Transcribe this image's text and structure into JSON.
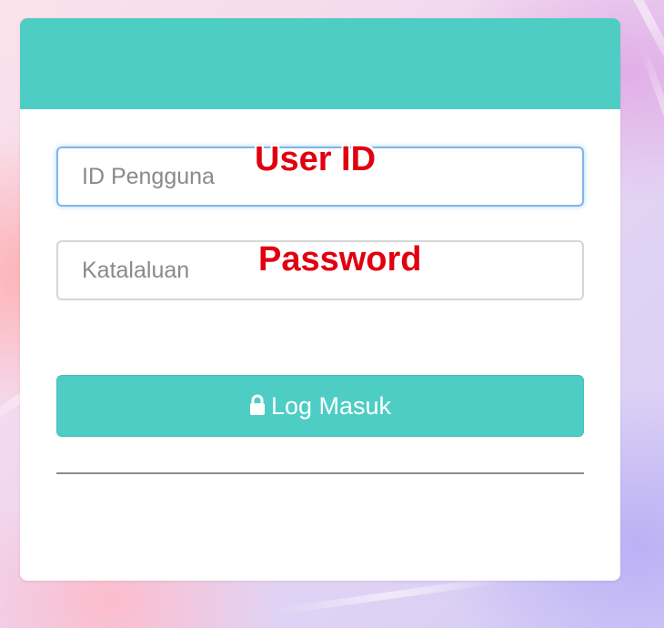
{
  "login_form": {
    "user_id_placeholder": "ID Pengguna",
    "password_placeholder": "Katalaluan",
    "submit_label": "Log Masuk",
    "submit_icon": "lock-icon"
  },
  "annotations": {
    "user_id": "User ID",
    "password": "Password"
  },
  "colors": {
    "accent": "#4ecdc4",
    "annotation_text": "#e0000f",
    "focus_border": "#7fb6ea"
  }
}
